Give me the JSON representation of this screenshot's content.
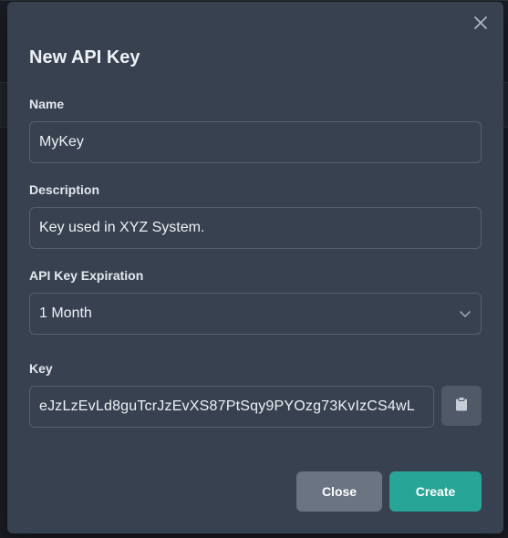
{
  "modal": {
    "title": "New API Key",
    "close_icon": "close-icon",
    "fields": {
      "name": {
        "label": "Name",
        "value": "MyKey"
      },
      "description": {
        "label": "Description",
        "value": "Key used in XYZ System."
      },
      "expiration": {
        "label": "API Key Expiration",
        "value": "1 Month",
        "icon": "chevron-down-icon"
      },
      "key": {
        "label": "Key",
        "value": "eJzLzEvLd8guTcrJzEvXS87PtSqy9PYOzg73KvIzCS4wL",
        "copy_icon": "clipboard-icon"
      }
    },
    "buttons": {
      "close_label": "Close",
      "create_label": "Create"
    }
  },
  "colors": {
    "modal_bg": "#384150",
    "accent": "#27a596",
    "secondary_button": "#6a7483"
  }
}
